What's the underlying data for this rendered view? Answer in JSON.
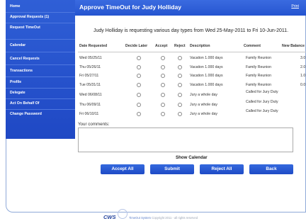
{
  "sidebar": {
    "items": [
      {
        "label": "Home"
      },
      {
        "label": "Approval Requests (1)"
      },
      {
        "label": "Request TimeOut"
      },
      {
        "label": "Calendar"
      },
      {
        "label": "Cancel Requests"
      },
      {
        "label": "Transactions"
      },
      {
        "label": "Profile"
      },
      {
        "label": "Delegate"
      },
      {
        "label": "Act On Behalf Of"
      },
      {
        "label": "Change Password"
      }
    ]
  },
  "header": {
    "title": "Approve TimeOut for Judy Holliday",
    "print_label": "Print"
  },
  "summary": "Judy Holliday is requesting various day types from Wed 25-May-2011 to Fri 10-Jun-2011.",
  "table": {
    "columns": [
      "Date Requested",
      "Decide Later",
      "Accept",
      "Reject",
      "Description",
      "Comment",
      "New Balance"
    ],
    "rows": [
      {
        "date": "Wed 05/25/11",
        "description": "Vacation 1.000 days",
        "comment": "Family Reunion",
        "balance": "3.0"
      },
      {
        "date": "Thu 05/26/11",
        "description": "Vacation 1.000 days",
        "comment": "Family Reunion",
        "balance": "2.0"
      },
      {
        "date": "Fri 05/27/11",
        "description": "Vacation 1.000 days",
        "comment": "Family Reunion",
        "balance": "1.0"
      },
      {
        "date": "Tue 05/31/11",
        "description": "Vacation 1.000 days",
        "comment": "Family Reunion",
        "balance": "0.0"
      },
      {
        "date": "Wed 06/08/11",
        "description": "Jury a whole day",
        "comment": "Called for Jury Duty",
        "balance": ""
      },
      {
        "date": "Thu 06/09/11",
        "description": "Jury a whole day",
        "comment": "Called for Jury Duty",
        "balance": ""
      },
      {
        "date": "Fri 06/10/11",
        "description": "Jury a whole day",
        "comment": "Called for Jury Duty",
        "balance": ""
      }
    ]
  },
  "comments": {
    "label": "Your comments:",
    "value": ""
  },
  "show_calendar_label": "Show Calendar",
  "buttons": {
    "accept_all": "Accept All",
    "submit": "Submit",
    "reject_all": "Reject All",
    "back": "Back"
  },
  "footer": {
    "logo": "CWS",
    "brand": "TimeOut System",
    "copyright": "Copyright 2011 - all rights reserved"
  }
}
